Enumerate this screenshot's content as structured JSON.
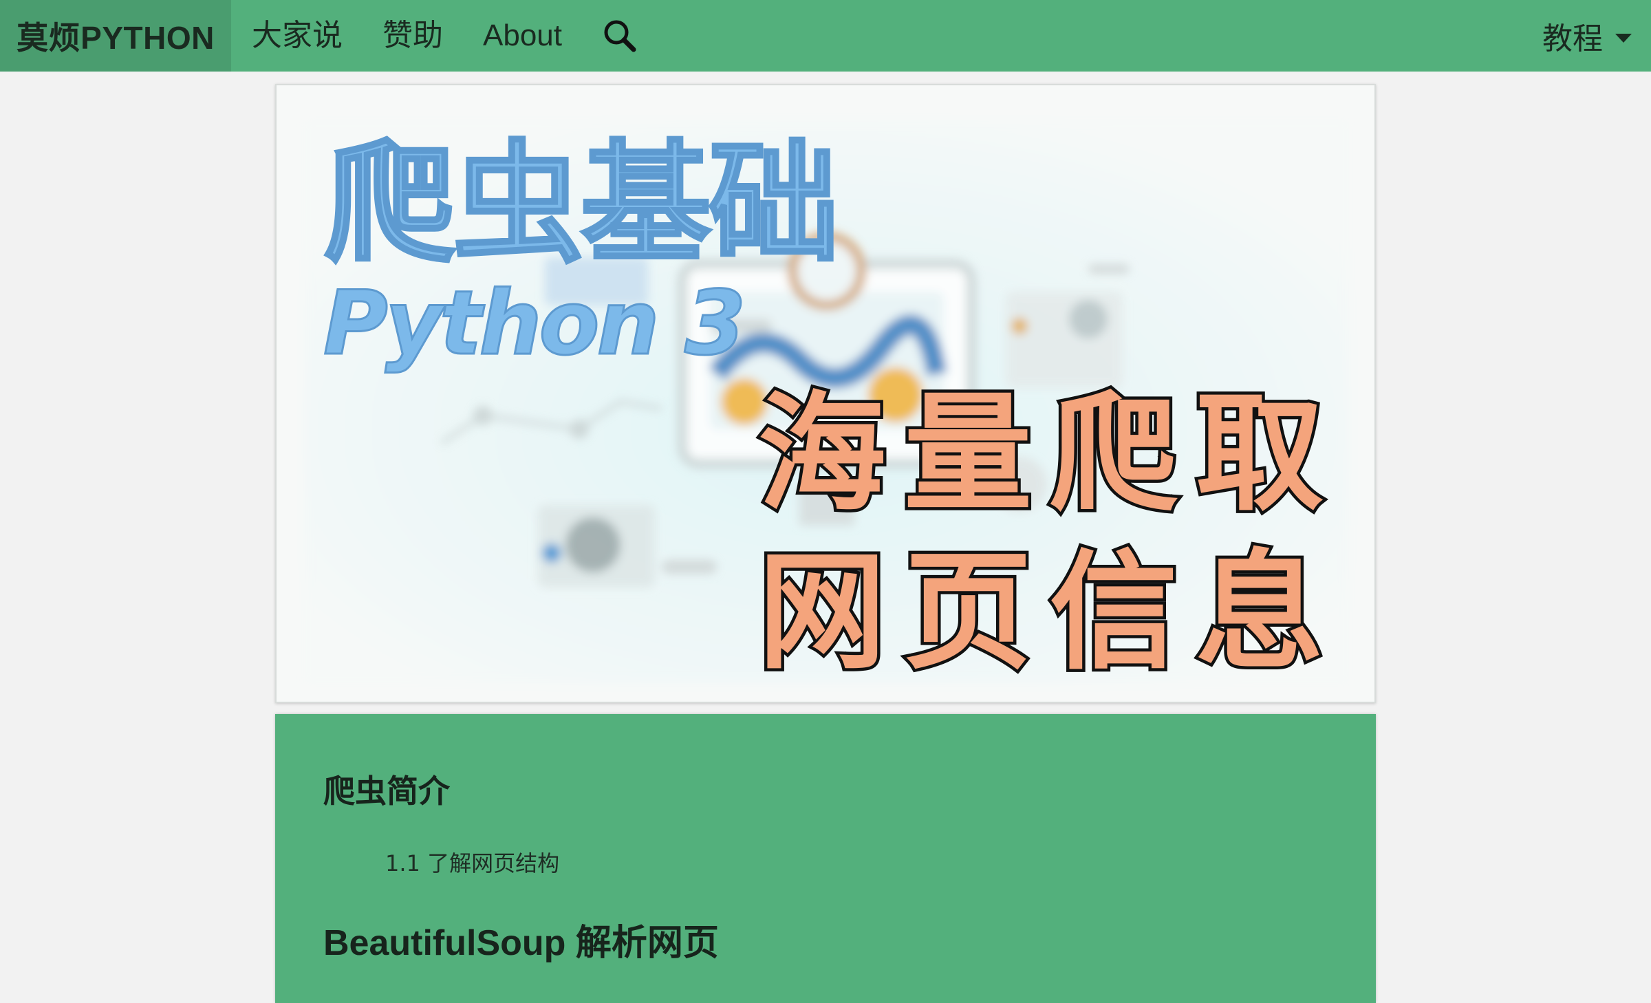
{
  "navbar": {
    "brand": "莫烦PYTHON",
    "items": [
      "大家说",
      "赞助",
      "About"
    ],
    "search_icon": "search-icon",
    "dropdown_label": "教程",
    "bg_color": "#53b07c",
    "brand_bg_color": "#4a9d6f"
  },
  "banner": {
    "title": "爬虫基础",
    "subtitle": "Python 3",
    "slogan_line1": "海量爬取",
    "slogan_line2": "网页信息",
    "title_color": "#7cb9ea",
    "slogan_color": "#f4a47c"
  },
  "contents": {
    "section1_title": "爬虫简介",
    "section1_items": [
      "1.1 了解网页结构"
    ],
    "section2_title": "BeautifulSoup 解析网页"
  }
}
